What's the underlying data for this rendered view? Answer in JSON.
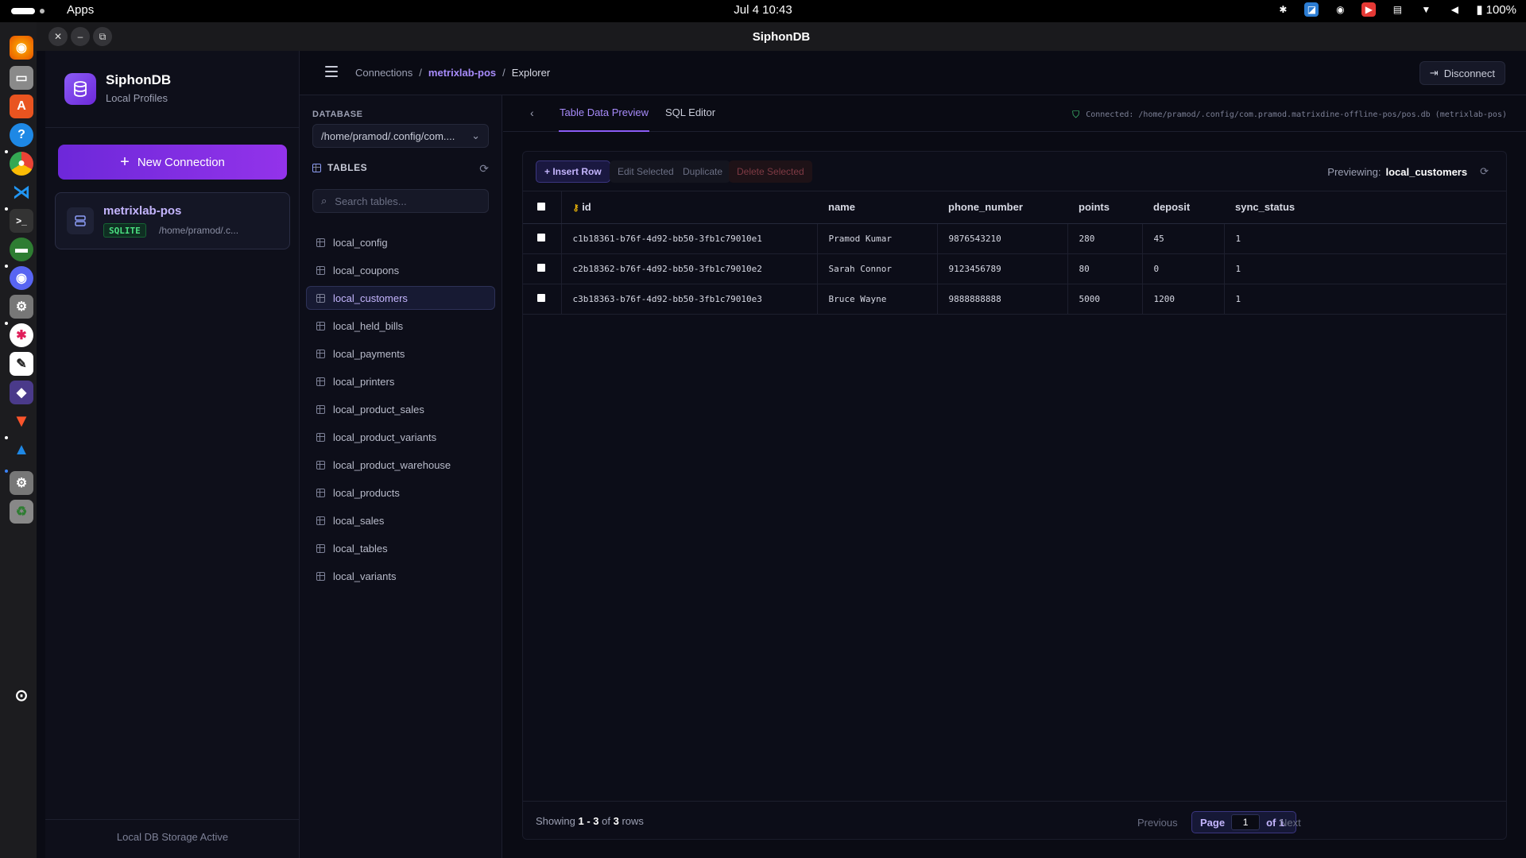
{
  "system": {
    "apps_label": "Apps",
    "clock": "Jul 4  10:43",
    "battery": "100%"
  },
  "window": {
    "title": "SiphonDB"
  },
  "sidebar": {
    "brand_name": "SiphonDB",
    "brand_sub": "Local Profiles",
    "new_connection": "New Connection",
    "connection": {
      "name": "metrixlab-pos",
      "badge": "SQLITE",
      "path": "/home/pramod/.c..."
    },
    "storage_status": "Local DB Storage Active"
  },
  "header": {
    "crumbs": [
      "Connections",
      "metrixlab-pos",
      "Explorer"
    ],
    "disconnect": "Disconnect"
  },
  "db_panel": {
    "database_label": "DATABASE",
    "database_value": "/home/pramod/.config/com....",
    "tables_label": "TABLES",
    "search_placeholder": "Search tables...",
    "tables": [
      "local_config",
      "local_coupons",
      "local_customers",
      "local_held_bills",
      "local_payments",
      "local_printers",
      "local_product_sales",
      "local_product_variants",
      "local_product_warehouse",
      "local_products",
      "local_sales",
      "local_tables",
      "local_variants"
    ],
    "selected": "local_customers"
  },
  "main": {
    "tabs": [
      "Table Data Preview",
      "SQL Editor"
    ],
    "connected": "Connected: /home/pramod/.config/com.pramod.matrixdine-offline-pos/pos.db (metrixlab-pos)",
    "toolbar": {
      "insert": "+ Insert Row",
      "edit": "Edit Selected",
      "duplicate": "Duplicate",
      "delete": "Delete Selected",
      "previewing_label": "Previewing:",
      "previewing_table": "local_customers"
    },
    "columns": [
      "id",
      "name",
      "phone_number",
      "points",
      "deposit",
      "sync_status"
    ],
    "rows": [
      [
        "c1b18361-b76f-4d92-bb50-3fb1c79010e1",
        "Pramod Kumar",
        "9876543210",
        "280",
        "45",
        "1"
      ],
      [
        "c2b18362-b76f-4d92-bb50-3fb1c79010e2",
        "Sarah Connor",
        "9123456789",
        "80",
        "0",
        "1"
      ],
      [
        "c3b18363-b76f-4d92-bb50-3fb1c79010e3",
        "Bruce Wayne",
        "9888888888",
        "5000",
        "1200",
        "1"
      ]
    ],
    "footer": {
      "showing_prefix": "Showing",
      "range": "1 - 3",
      "of": "of",
      "total": "3",
      "rows_word": "rows",
      "previous": "Previous",
      "page_label": "Page",
      "page_value": "1",
      "of_pages": "of 1",
      "next": "Next"
    }
  },
  "colors": {
    "accent": "#8b5cf6",
    "success": "#4ade80",
    "danger": "#7f3a44"
  }
}
